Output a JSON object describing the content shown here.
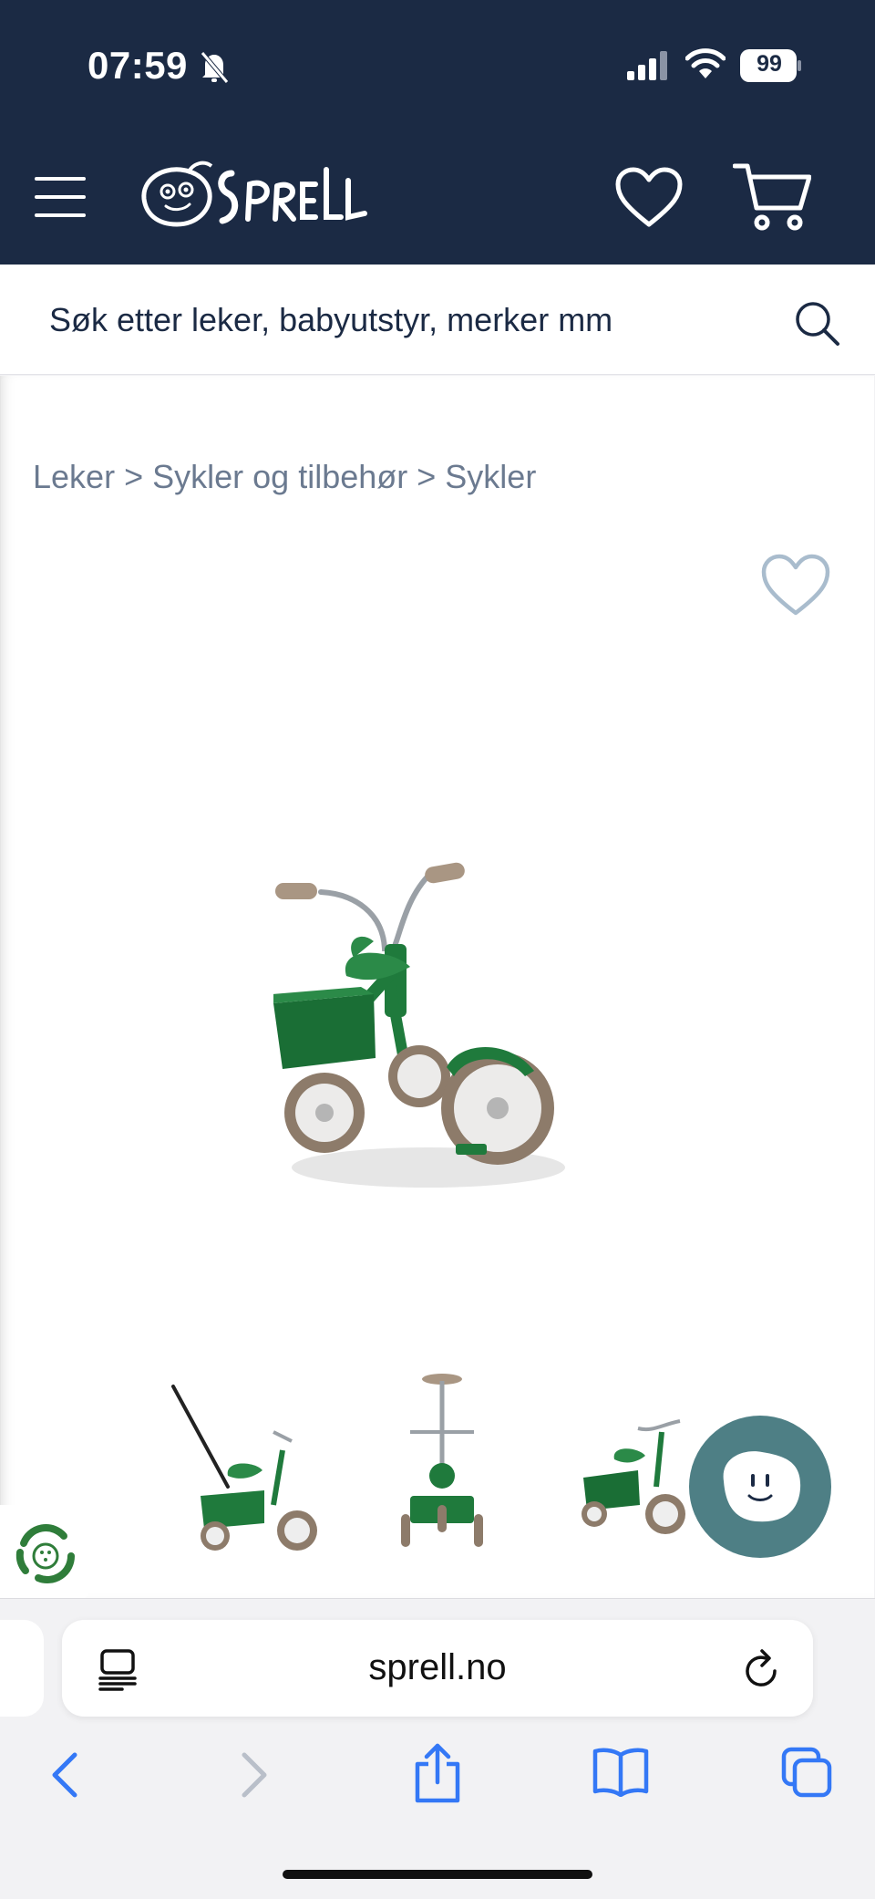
{
  "status_bar": {
    "time": "07:59",
    "battery": "99",
    "icons": [
      "bell-slash-icon",
      "signal-icon",
      "wifi-icon",
      "battery-icon"
    ]
  },
  "header": {
    "logo_text": "SPRELL",
    "icons": [
      "menu-icon",
      "heart-icon",
      "cart-icon"
    ],
    "background": "#1b2a44"
  },
  "search": {
    "placeholder": "Søk etter leker, babyutstyr, merker mm"
  },
  "breadcrumb": {
    "items": [
      "Leker",
      "Sykler og tilbehør",
      "Sykler"
    ],
    "separator": ">"
  },
  "product": {
    "main_image": "green tricycle with rear tray",
    "thumbnails": [
      "tricycle with push handle",
      "tricycle front view with push handle",
      "tricycle side view"
    ],
    "accent": "#1f7a3c"
  },
  "chat": {
    "color": "#4e7f85"
  },
  "browser": {
    "url": "sprell.no",
    "icons": [
      "reader-icon",
      "reload-icon",
      "back-icon",
      "forward-icon",
      "share-icon",
      "bookmarks-icon",
      "tabs-icon"
    ],
    "accent": "#3478f6"
  }
}
